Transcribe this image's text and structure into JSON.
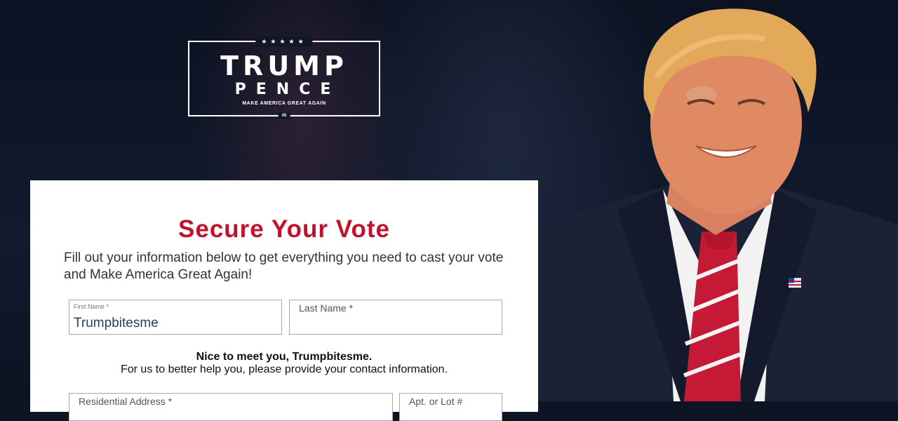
{
  "logo": {
    "stars": "★★★★★",
    "top": "TRUMP",
    "middle": "PENCE",
    "slogan": "MAKE AMERICA GREAT AGAIN",
    "number": "45"
  },
  "form": {
    "title": "Secure Your Vote",
    "subtitle": "Fill out your information below to get everything you need to cast your vote and Make America Great Again!",
    "first_name": {
      "label": "First Name *",
      "value": "Trumpbitesme"
    },
    "last_name": {
      "label": "Last Name *",
      "value": ""
    },
    "greeting": "Nice to meet you, Trumpbitesme.",
    "help_text": "For us to better help you, please provide your contact information.",
    "address": {
      "label": "Residential Address *"
    },
    "apt": {
      "label": "Apt. or Lot #"
    }
  },
  "colors": {
    "accent": "#c0122d",
    "background": "#0d1424"
  }
}
